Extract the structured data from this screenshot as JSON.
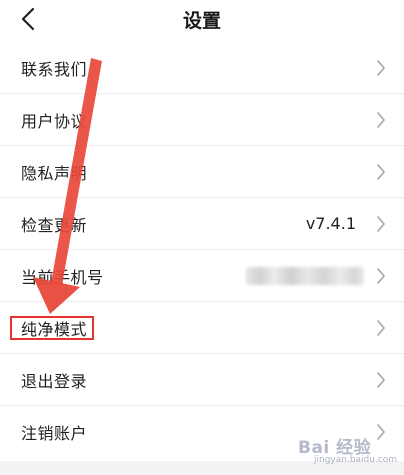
{
  "header": {
    "title": "设置",
    "back_icon": "chevron-left-icon"
  },
  "settings_items": [
    {
      "label": "联系我们",
      "value": ""
    },
    {
      "label": "用户协议",
      "value": ""
    },
    {
      "label": "隐私声明",
      "value": ""
    },
    {
      "label": "检查更新",
      "value": "v7.4.1"
    },
    {
      "label": "当前手机号",
      "value": ""
    },
    {
      "label": "纯净模式",
      "value": ""
    },
    {
      "label": "退出登录",
      "value": ""
    },
    {
      "label": "注销账户",
      "value": ""
    }
  ],
  "chevron_icon": "chevron-right-icon",
  "annotation": {
    "arrow_color": "#e8483a",
    "highlight_color": "#e2342d",
    "highlighted_item": "纯净模式"
  },
  "watermark": {
    "text": "Bai 经验",
    "sub": "jingyan.baidu.com"
  }
}
